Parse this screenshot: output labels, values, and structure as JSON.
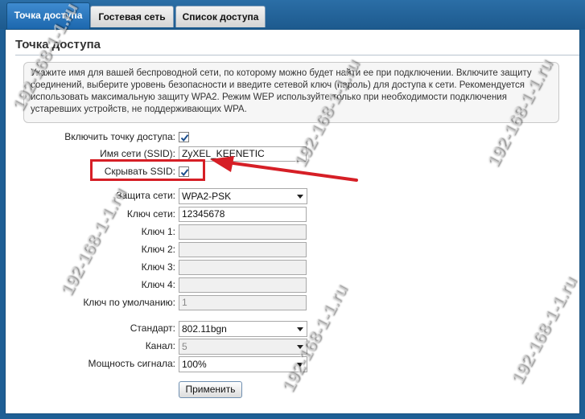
{
  "tabs": [
    {
      "label": "Точка доступа",
      "active": true
    },
    {
      "label": "Гостевая сеть",
      "active": false
    },
    {
      "label": "Список доступа",
      "active": false
    }
  ],
  "page_title": "Точка доступа",
  "info_text": "Укажите имя для вашей беспроводной сети, по которому можно будет найти ее при подключении. Включите защиту соединений, выберите уровень безопасности и введите сетевой ключ (пароль) для доступа к сети. Рекомендуется использовать максимальную защиту WPA2. Режим WEP используйте только при необходимости подключения устаревших устройств, не поддерживающих WPA.",
  "form": {
    "enable_ap": {
      "label": "Включить точку доступа:",
      "checked": true
    },
    "ssid": {
      "label": "Имя сети (SSID):",
      "value": "ZyXEL_KEENETIC"
    },
    "hide_ssid": {
      "label": "Скрывать SSID:",
      "checked": true
    },
    "security": {
      "label": "Защита сети:",
      "value": "WPA2-PSK"
    },
    "network_key": {
      "label": "Ключ сети:",
      "value": "12345678"
    },
    "key1": {
      "label": "Ключ 1:",
      "value": ""
    },
    "key2": {
      "label": "Ключ 2:",
      "value": ""
    },
    "key3": {
      "label": "Ключ 3:",
      "value": ""
    },
    "key4": {
      "label": "Ключ 4:",
      "value": ""
    },
    "default_key": {
      "label": "Ключ по умолчанию:",
      "value": "1"
    },
    "standard": {
      "label": "Стандарт:",
      "value": "802.11bgn"
    },
    "channel": {
      "label": "Канал:",
      "value": "5"
    },
    "power": {
      "label": "Мощность сигнала:",
      "value": "100%"
    }
  },
  "apply_label": "Применить",
  "watermark": "192-168-1-1.ru",
  "colors": {
    "highlight": "#d61f26",
    "tab_active": "#1c67ad",
    "frame": "#1e5f95"
  }
}
